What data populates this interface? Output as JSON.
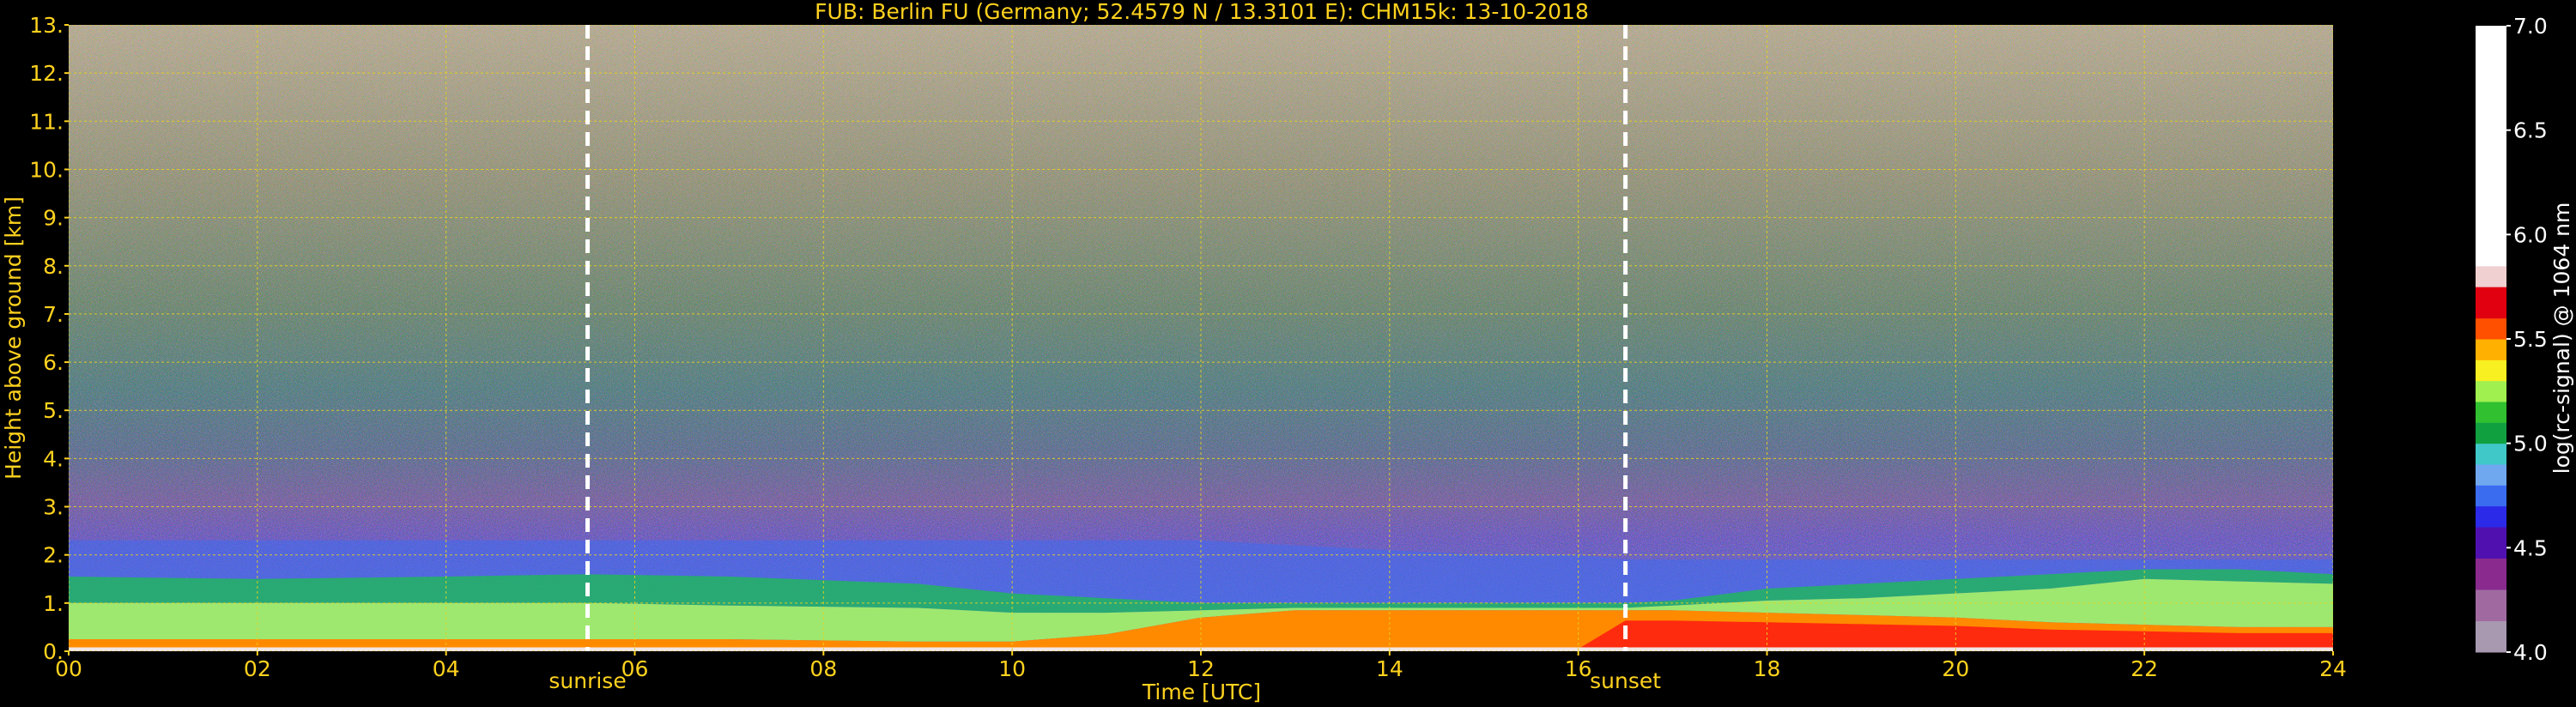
{
  "chart_data": {
    "type": "heatmap",
    "title": "FUB: Berlin FU (Germany; 52.4579 N / 13.3101 E):    CHM15k: 13-10-2018",
    "xlabel": "Time [UTC]",
    "ylabel": "Height above ground [km]",
    "colorbar_label": "log(rc-signal) @ 1064 nm",
    "xlim": [
      0,
      24
    ],
    "ylim": [
      0,
      13
    ],
    "x_ticks": [
      0,
      2,
      4,
      6,
      8,
      10,
      12,
      14,
      16,
      18,
      20,
      22,
      24
    ],
    "x_tick_labels": [
      "00",
      "02",
      "04",
      "06",
      "08",
      "10",
      "12",
      "14",
      "16",
      "18",
      "20",
      "22",
      "24"
    ],
    "y_ticks": [
      0,
      1,
      2,
      3,
      4,
      5,
      6,
      7,
      8,
      9,
      10,
      11,
      12,
      13
    ],
    "y_tick_labels": [
      "0.",
      "1.",
      "2.",
      "3.",
      "4.",
      "5.",
      "6.",
      "7.",
      "8.",
      "9.",
      "10.",
      "11.",
      "12.",
      "13."
    ],
    "grid": true,
    "colorbar_range": [
      4.0,
      7.0
    ],
    "colorbar_ticks": [
      4.0,
      4.5,
      5.0,
      5.5,
      6.0,
      6.5,
      7.0
    ],
    "colorbar_tick_labels": [
      "4.0",
      "4.5",
      "5.0",
      "5.5",
      "6.0",
      "6.5",
      "7.0"
    ],
    "annotations": [
      {
        "text": "sunrise",
        "x": 5.5
      },
      {
        "text": "sunset",
        "x": 16.5
      }
    ],
    "layers": {
      "times": [
        0,
        2,
        4,
        5.5,
        7,
        9,
        10,
        11,
        12,
        13,
        14,
        15,
        16,
        16.5,
        17,
        18,
        19,
        20,
        21,
        22,
        23,
        24
      ],
      "surface_top_km": [
        0.25,
        0.25,
        0.25,
        0.25,
        0.25,
        0.2,
        0.2,
        0.35,
        0.7,
        0.85,
        0.85,
        0.85,
        0.85,
        0.85,
        0.85,
        0.8,
        0.75,
        0.7,
        0.6,
        0.55,
        0.5,
        0.5
      ],
      "pbl_top_km": [
        1.0,
        1.0,
        1.0,
        1.0,
        0.95,
        0.9,
        0.8,
        0.8,
        0.85,
        0.9,
        0.9,
        0.9,
        0.9,
        0.9,
        0.95,
        1.05,
        1.1,
        1.2,
        1.3,
        1.5,
        1.45,
        1.4
      ],
      "residual_top_km": [
        1.55,
        1.5,
        1.55,
        1.6,
        1.55,
        1.4,
        1.2,
        1.1,
        1.0,
        1.0,
        1.0,
        1.0,
        1.0,
        1.0,
        1.05,
        1.3,
        1.4,
        1.5,
        1.6,
        1.7,
        1.7,
        1.6
      ],
      "aerosol_top_km": [
        2.3,
        2.3,
        2.3,
        2.3,
        2.3,
        2.3,
        2.3,
        2.3,
        2.3,
        2.2,
        2.1,
        2.0,
        2.0,
        1.9,
        1.9,
        1.9,
        1.9,
        1.9,
        1.9,
        1.9,
        1.9,
        1.9
      ]
    },
    "colors": {
      "background": "#000000",
      "axis_text": "#ffd21e",
      "grid": "#e6d21e",
      "colorbar_label": "#ffffff"
    }
  }
}
